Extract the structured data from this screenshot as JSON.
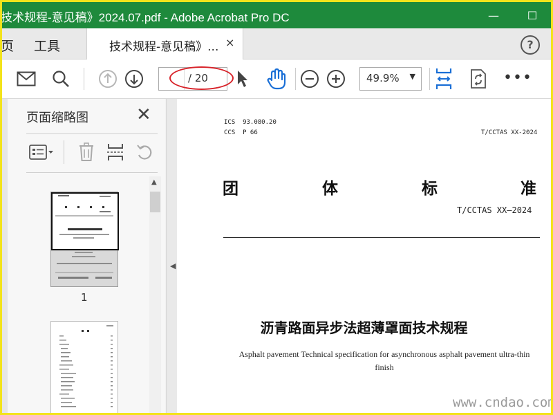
{
  "window": {
    "title": "技术规程-意见稿》2024.07.pdf - Adobe Acrobat Pro DC",
    "minimize_glyph": "—",
    "maximize_glyph": "☐"
  },
  "tabs": {
    "home_label": "页",
    "tools_label": "工具",
    "document_tab": "技术规程-意见稿》...",
    "close_glyph": "×",
    "help_glyph": "?"
  },
  "toolbar": {
    "page_input_value": "",
    "page_total": "/ 20",
    "zoom_value": "49.9%",
    "zoom_arrow": "▼",
    "more_glyph": "•••",
    "icons": [
      "envelope-icon",
      "search-icon",
      "prev-page-icon",
      "next-page-icon",
      "select-cursor-icon",
      "hand-tool-icon",
      "zoom-out-icon",
      "zoom-in-icon",
      "fit-width-icon",
      "rotate-icon",
      "more-icon"
    ]
  },
  "sidepanel": {
    "title": "页面缩略图",
    "close_glyph": "✕",
    "thumbnails": [
      {
        "page_label": "1"
      },
      {
        "page_label": ""
      }
    ]
  },
  "document": {
    "ics": "ICS  93.080.20",
    "ccs": "CCS  P 66",
    "code_top": "T/CCTAS XX-2024",
    "big_chars": [
      "团",
      "体",
      "标",
      "准"
    ],
    "standard_number": "T/CCTAS XX—2024",
    "title_cn": "沥青路面异步法超薄罩面技术规程",
    "title_en": "Asphalt pavement Technical specification for asynchronous asphalt pavement ultra-thin finish"
  },
  "watermark": "www.cndao.com",
  "colors": {
    "titlebar": "#1e8a3c",
    "frame": "#f3e31b",
    "icon_blue": "#1a6fd6",
    "annotation_red": "#d8232a"
  }
}
